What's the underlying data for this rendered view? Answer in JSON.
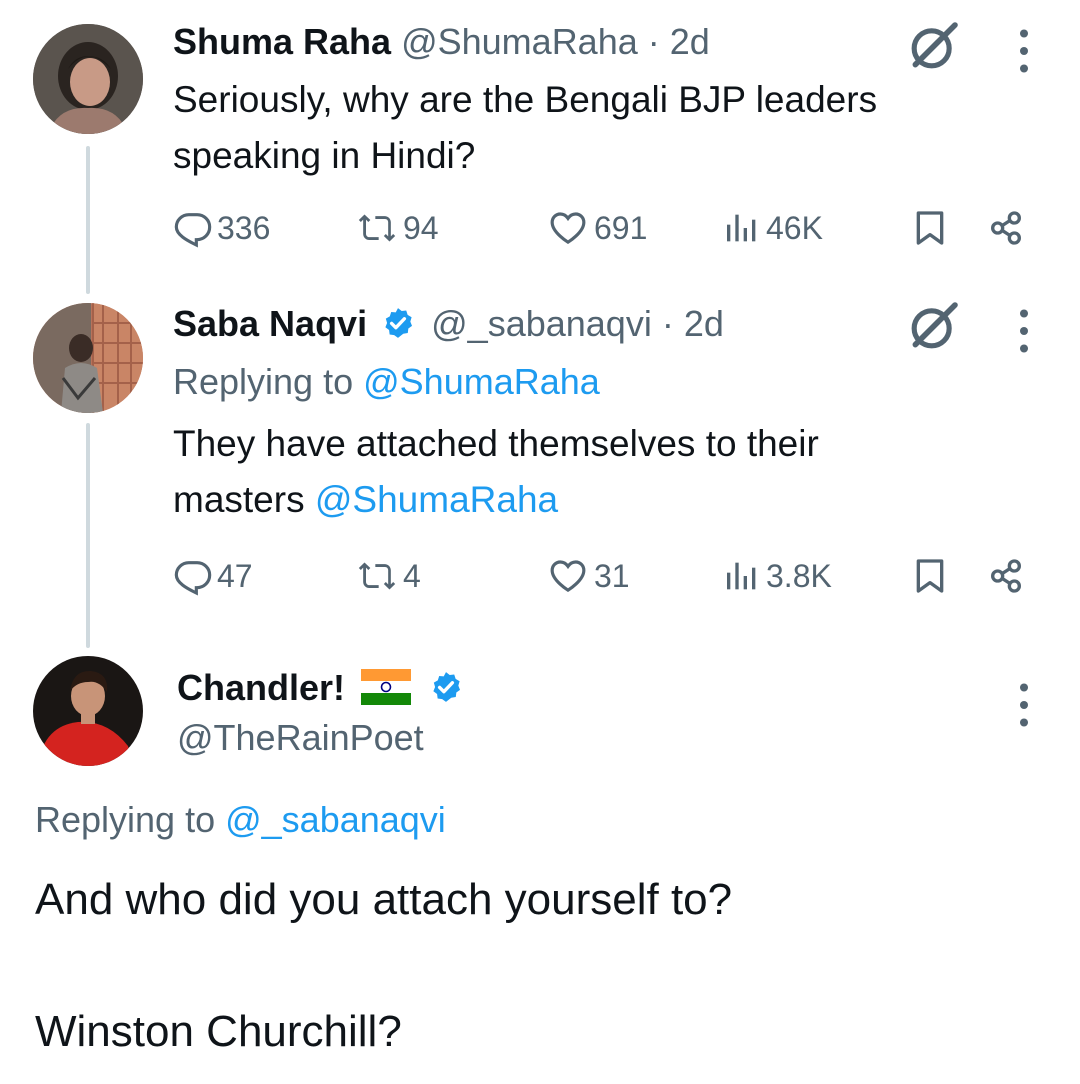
{
  "tweets": [
    {
      "name": "Shuma Raha",
      "handle": "@ShumaRaha",
      "time": "· 2d",
      "text_lines": [
        "Seriously, why are the Bengali BJP leaders",
        "speaking in Hindi?"
      ],
      "replies": "336",
      "retweets": "94",
      "likes": "691",
      "views": "46K"
    },
    {
      "name": "Saba Naqvi",
      "handle": "@_sabanaqvi",
      "time": "· 2d",
      "replying_prefix": "Replying to ",
      "replying_to": "@ShumaRaha",
      "text_line1": "They have attached themselves to their",
      "text_line2_prefix": "masters ",
      "text_line2_mention": "@ShumaRaha",
      "replies": "47",
      "retweets": "4",
      "likes": "31",
      "views": "3.8K"
    }
  ],
  "main_tweet": {
    "name": "Chandler!",
    "handle": "@TheRainPoet",
    "replying_prefix": "Replying to ",
    "replying_to": "@_sabanaqvi",
    "text_line1": "And who did you attach yourself to?",
    "text_line2": "Winston Churchill?"
  },
  "colors": {
    "accent": "#1d9bf0",
    "secondary_text": "#536471",
    "primary_text": "#0f1419",
    "thread_line": "#cfd9de"
  },
  "icons": [
    "reply-icon",
    "retweet-icon",
    "like-icon",
    "views-icon",
    "bookmark-icon",
    "share-icon",
    "grok-icon",
    "more-icon",
    "verified-badge-icon",
    "india-flag-icon"
  ]
}
